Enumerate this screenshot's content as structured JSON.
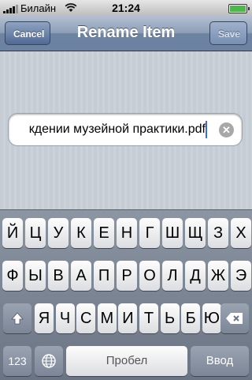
{
  "status": {
    "carrier": "Билайн",
    "time": "21:24"
  },
  "navbar": {
    "title": "Rename Item",
    "cancel": "Cancel",
    "save": "Save"
  },
  "field": {
    "value": "кдении музейной практики.pdf"
  },
  "keyboard": {
    "row1": [
      "Й",
      "Ц",
      "У",
      "К",
      "Е",
      "Н",
      "Г",
      "Ш",
      "Щ",
      "З",
      "Х"
    ],
    "row2": [
      "Ф",
      "Ы",
      "В",
      "А",
      "П",
      "Р",
      "О",
      "Л",
      "Д",
      "Ж",
      "Э"
    ],
    "row3": [
      "Я",
      "Ч",
      "С",
      "М",
      "И",
      "Т",
      "Ь",
      "Б",
      "Ю"
    ],
    "numbers_label": "123",
    "space_label": "Пробел",
    "return_label": "Ввод"
  },
  "colors": {
    "nav": "#6d83a2",
    "caret": "#3d6ae0",
    "battery": "#4cb848"
  }
}
